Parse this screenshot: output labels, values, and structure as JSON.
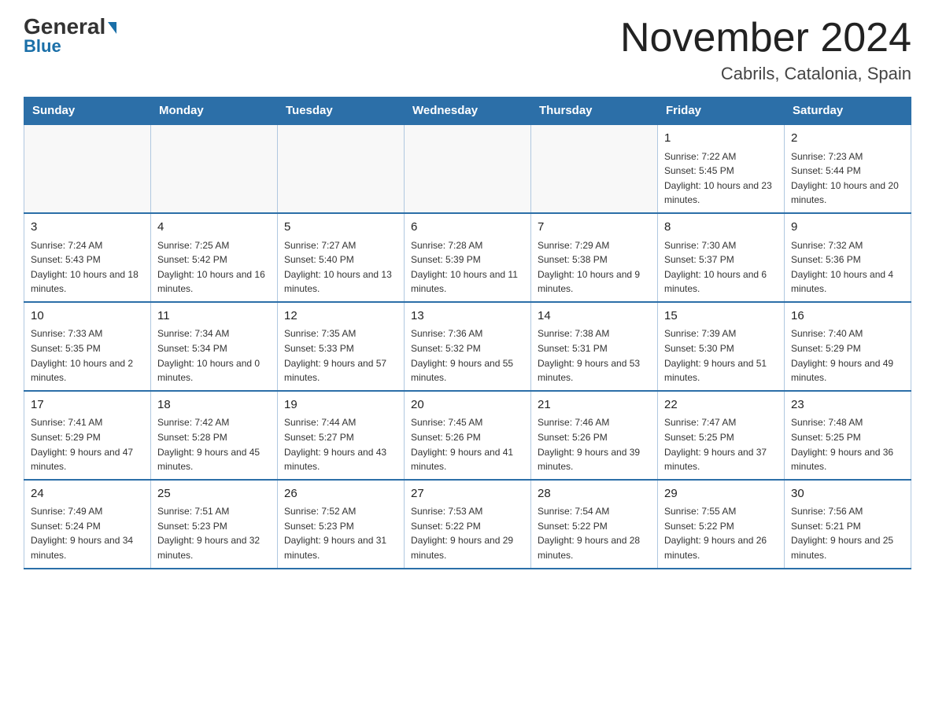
{
  "logo": {
    "line1_black": "General",
    "line1_blue_arrow": "▶",
    "line2": "Blue"
  },
  "title": "November 2024",
  "subtitle": "Cabrils, Catalonia, Spain",
  "weekdays": [
    "Sunday",
    "Monday",
    "Tuesday",
    "Wednesday",
    "Thursday",
    "Friday",
    "Saturday"
  ],
  "weeks": [
    [
      {
        "day": "",
        "sunrise": "",
        "sunset": "",
        "daylight": ""
      },
      {
        "day": "",
        "sunrise": "",
        "sunset": "",
        "daylight": ""
      },
      {
        "day": "",
        "sunrise": "",
        "sunset": "",
        "daylight": ""
      },
      {
        "day": "",
        "sunrise": "",
        "sunset": "",
        "daylight": ""
      },
      {
        "day": "",
        "sunrise": "",
        "sunset": "",
        "daylight": ""
      },
      {
        "day": "1",
        "sunrise": "Sunrise: 7:22 AM",
        "sunset": "Sunset: 5:45 PM",
        "daylight": "Daylight: 10 hours and 23 minutes."
      },
      {
        "day": "2",
        "sunrise": "Sunrise: 7:23 AM",
        "sunset": "Sunset: 5:44 PM",
        "daylight": "Daylight: 10 hours and 20 minutes."
      }
    ],
    [
      {
        "day": "3",
        "sunrise": "Sunrise: 7:24 AM",
        "sunset": "Sunset: 5:43 PM",
        "daylight": "Daylight: 10 hours and 18 minutes."
      },
      {
        "day": "4",
        "sunrise": "Sunrise: 7:25 AM",
        "sunset": "Sunset: 5:42 PM",
        "daylight": "Daylight: 10 hours and 16 minutes."
      },
      {
        "day": "5",
        "sunrise": "Sunrise: 7:27 AM",
        "sunset": "Sunset: 5:40 PM",
        "daylight": "Daylight: 10 hours and 13 minutes."
      },
      {
        "day": "6",
        "sunrise": "Sunrise: 7:28 AM",
        "sunset": "Sunset: 5:39 PM",
        "daylight": "Daylight: 10 hours and 11 minutes."
      },
      {
        "day": "7",
        "sunrise": "Sunrise: 7:29 AM",
        "sunset": "Sunset: 5:38 PM",
        "daylight": "Daylight: 10 hours and 9 minutes."
      },
      {
        "day": "8",
        "sunrise": "Sunrise: 7:30 AM",
        "sunset": "Sunset: 5:37 PM",
        "daylight": "Daylight: 10 hours and 6 minutes."
      },
      {
        "day": "9",
        "sunrise": "Sunrise: 7:32 AM",
        "sunset": "Sunset: 5:36 PM",
        "daylight": "Daylight: 10 hours and 4 minutes."
      }
    ],
    [
      {
        "day": "10",
        "sunrise": "Sunrise: 7:33 AM",
        "sunset": "Sunset: 5:35 PM",
        "daylight": "Daylight: 10 hours and 2 minutes."
      },
      {
        "day": "11",
        "sunrise": "Sunrise: 7:34 AM",
        "sunset": "Sunset: 5:34 PM",
        "daylight": "Daylight: 10 hours and 0 minutes."
      },
      {
        "day": "12",
        "sunrise": "Sunrise: 7:35 AM",
        "sunset": "Sunset: 5:33 PM",
        "daylight": "Daylight: 9 hours and 57 minutes."
      },
      {
        "day": "13",
        "sunrise": "Sunrise: 7:36 AM",
        "sunset": "Sunset: 5:32 PM",
        "daylight": "Daylight: 9 hours and 55 minutes."
      },
      {
        "day": "14",
        "sunrise": "Sunrise: 7:38 AM",
        "sunset": "Sunset: 5:31 PM",
        "daylight": "Daylight: 9 hours and 53 minutes."
      },
      {
        "day": "15",
        "sunrise": "Sunrise: 7:39 AM",
        "sunset": "Sunset: 5:30 PM",
        "daylight": "Daylight: 9 hours and 51 minutes."
      },
      {
        "day": "16",
        "sunrise": "Sunrise: 7:40 AM",
        "sunset": "Sunset: 5:29 PM",
        "daylight": "Daylight: 9 hours and 49 minutes."
      }
    ],
    [
      {
        "day": "17",
        "sunrise": "Sunrise: 7:41 AM",
        "sunset": "Sunset: 5:29 PM",
        "daylight": "Daylight: 9 hours and 47 minutes."
      },
      {
        "day": "18",
        "sunrise": "Sunrise: 7:42 AM",
        "sunset": "Sunset: 5:28 PM",
        "daylight": "Daylight: 9 hours and 45 minutes."
      },
      {
        "day": "19",
        "sunrise": "Sunrise: 7:44 AM",
        "sunset": "Sunset: 5:27 PM",
        "daylight": "Daylight: 9 hours and 43 minutes."
      },
      {
        "day": "20",
        "sunrise": "Sunrise: 7:45 AM",
        "sunset": "Sunset: 5:26 PM",
        "daylight": "Daylight: 9 hours and 41 minutes."
      },
      {
        "day": "21",
        "sunrise": "Sunrise: 7:46 AM",
        "sunset": "Sunset: 5:26 PM",
        "daylight": "Daylight: 9 hours and 39 minutes."
      },
      {
        "day": "22",
        "sunrise": "Sunrise: 7:47 AM",
        "sunset": "Sunset: 5:25 PM",
        "daylight": "Daylight: 9 hours and 37 minutes."
      },
      {
        "day": "23",
        "sunrise": "Sunrise: 7:48 AM",
        "sunset": "Sunset: 5:25 PM",
        "daylight": "Daylight: 9 hours and 36 minutes."
      }
    ],
    [
      {
        "day": "24",
        "sunrise": "Sunrise: 7:49 AM",
        "sunset": "Sunset: 5:24 PM",
        "daylight": "Daylight: 9 hours and 34 minutes."
      },
      {
        "day": "25",
        "sunrise": "Sunrise: 7:51 AM",
        "sunset": "Sunset: 5:23 PM",
        "daylight": "Daylight: 9 hours and 32 minutes."
      },
      {
        "day": "26",
        "sunrise": "Sunrise: 7:52 AM",
        "sunset": "Sunset: 5:23 PM",
        "daylight": "Daylight: 9 hours and 31 minutes."
      },
      {
        "day": "27",
        "sunrise": "Sunrise: 7:53 AM",
        "sunset": "Sunset: 5:22 PM",
        "daylight": "Daylight: 9 hours and 29 minutes."
      },
      {
        "day": "28",
        "sunrise": "Sunrise: 7:54 AM",
        "sunset": "Sunset: 5:22 PM",
        "daylight": "Daylight: 9 hours and 28 minutes."
      },
      {
        "day": "29",
        "sunrise": "Sunrise: 7:55 AM",
        "sunset": "Sunset: 5:22 PM",
        "daylight": "Daylight: 9 hours and 26 minutes."
      },
      {
        "day": "30",
        "sunrise": "Sunrise: 7:56 AM",
        "sunset": "Sunset: 5:21 PM",
        "daylight": "Daylight: 9 hours and 25 minutes."
      }
    ]
  ]
}
